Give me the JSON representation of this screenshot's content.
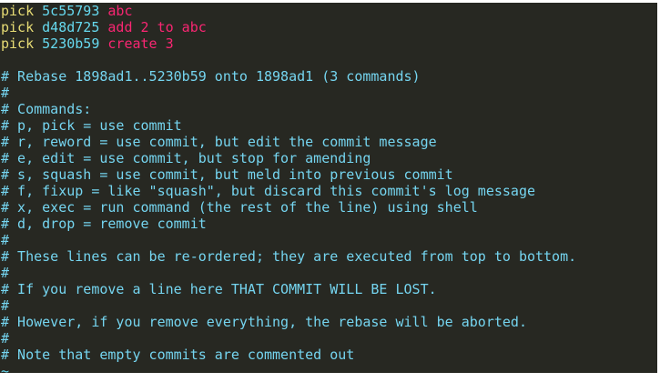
{
  "editor": {
    "picks": [
      {
        "command": "pick",
        "hash": "5c55793",
        "message": "abc"
      },
      {
        "command": "pick",
        "hash": "d48d725",
        "message": "add 2 to abc"
      },
      {
        "command": "pick",
        "hash": "5230b59",
        "message": "create 3"
      }
    ],
    "comments": [
      "# Rebase 1898ad1..5230b59 onto 1898ad1 (3 commands)",
      "#",
      "# Commands:",
      "# p, pick = use commit",
      "# r, reword = use commit, but edit the commit message",
      "# e, edit = use commit, but stop for amending",
      "# s, squash = use commit, but meld into previous commit",
      "# f, fixup = like \"squash\", but discard this commit's log message",
      "# x, exec = run command (the rest of the line) using shell",
      "# d, drop = remove commit",
      "#",
      "# These lines can be re-ordered; they are executed from top to bottom.",
      "#",
      "# If you remove a line here THAT COMMIT WILL BE LOST.",
      "#",
      "# However, if you remove everything, the rebase will be aborted.",
      "#",
      "# Note that empty commits are commented out"
    ],
    "tilde": "~",
    "colors": {
      "background": "#272822",
      "keyword": "#e6db74",
      "hash": "#66d9ef",
      "message": "#f92672",
      "comment": "#75d5f0"
    }
  }
}
